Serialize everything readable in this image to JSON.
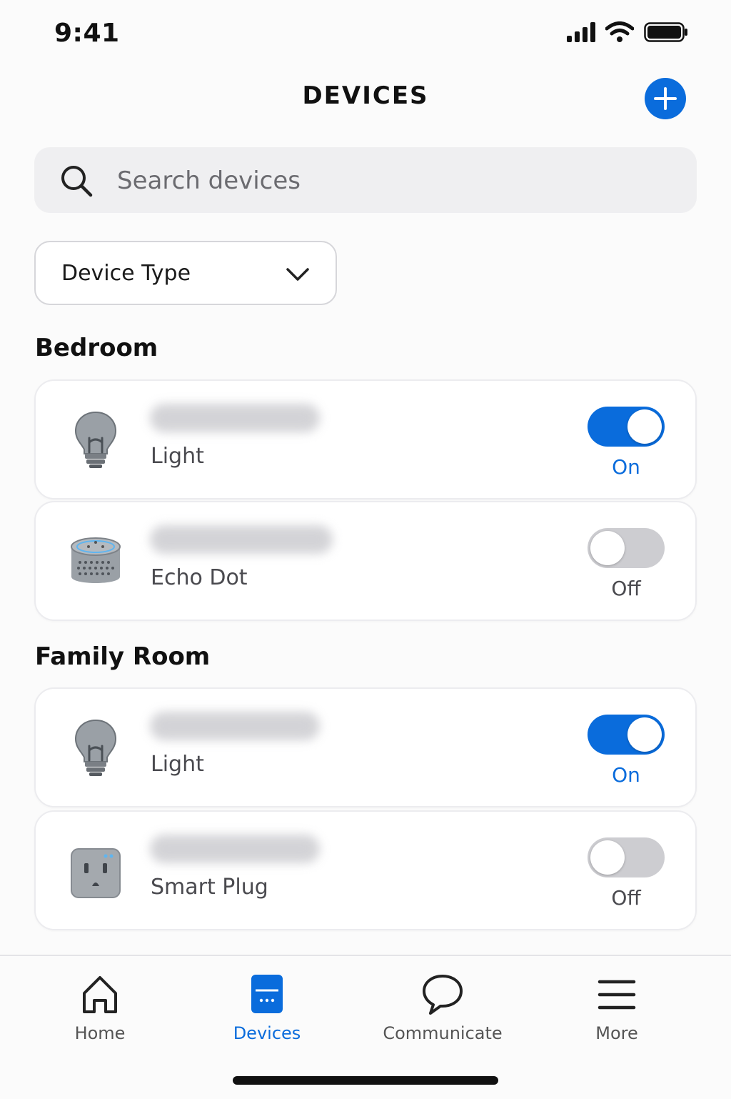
{
  "status_bar": {
    "time": "9:41"
  },
  "header": {
    "title": "DEVICES",
    "add_icon": "plus-icon"
  },
  "search": {
    "placeholder": "Search devices",
    "value": ""
  },
  "filter": {
    "label": "Device Type"
  },
  "sections": [
    {
      "title": "Bedroom",
      "devices": [
        {
          "type": "Light",
          "icon": "light-bulb-icon",
          "state": "On",
          "on": true
        },
        {
          "type": "Echo Dot",
          "icon": "echo-dot-icon",
          "state": "Off",
          "on": false
        }
      ]
    },
    {
      "title": "Family Room",
      "devices": [
        {
          "type": "Light",
          "icon": "light-bulb-icon",
          "state": "On",
          "on": true
        },
        {
          "type": "Smart Plug",
          "icon": "smart-plug-icon",
          "state": "Off",
          "on": false
        }
      ]
    }
  ],
  "tabs": [
    {
      "label": "Home",
      "icon": "home-icon",
      "active": false
    },
    {
      "label": "Devices",
      "icon": "devices-icon",
      "active": true
    },
    {
      "label": "Communicate",
      "icon": "chat-bubble-icon",
      "active": false
    },
    {
      "label": "More",
      "icon": "menu-icon",
      "active": false
    }
  ],
  "colors": {
    "accent": "#0a6cdc",
    "toggle_off": "#cdcdd1",
    "background": "#fbfbfb"
  }
}
